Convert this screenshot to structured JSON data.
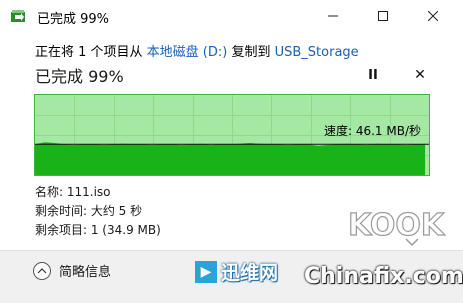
{
  "window": {
    "title": "已完成 99%"
  },
  "copy_line": {
    "prefix": "正在将 1 个项目从 ",
    "source": "本地磁盘 (D:)",
    "middle": " 复制到 ",
    "destination": "USB_Storage"
  },
  "progress": {
    "headline": "已完成 99%",
    "percent": 99,
    "pause_label": "II",
    "cancel_label": "✕"
  },
  "graph": {
    "speed_text": "速度: 46.1 MB/秒",
    "fill_color": "#19b219",
    "background_color": "#a4e8a4",
    "speed_history": [
      46,
      49,
      48,
      46,
      45,
      46,
      46,
      45,
      46,
      47,
      46,
      46,
      45,
      46,
      46,
      45,
      46,
      47,
      45,
      46,
      46,
      47,
      48,
      47,
      46,
      46,
      45,
      46,
      46,
      44,
      45,
      46,
      47,
      46,
      45,
      47,
      46,
      46,
      45,
      46,
      46
    ]
  },
  "details": {
    "name": "名称: 111.iso",
    "time_remaining": "剩余时间: 大约 5 秒",
    "items_remaining": "剩余项目: 1 (34.9 MB)"
  },
  "footer": {
    "fewer_details_label": "简略信息"
  },
  "watermarks": {
    "kook": "KOOK",
    "xunwei": "迅维网",
    "chinafix": "Chinafix.com"
  }
}
